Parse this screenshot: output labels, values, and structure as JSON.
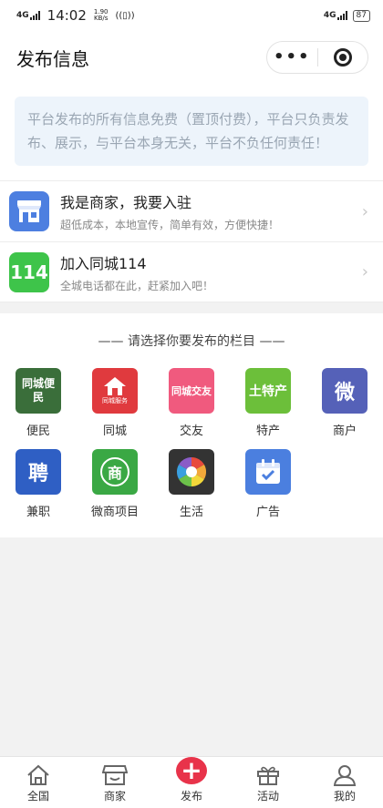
{
  "status_bar": {
    "network_left": "4G",
    "time": "14:02",
    "speed_value": "1.90",
    "speed_unit": "KB/s",
    "network_right": "4G",
    "battery": "87"
  },
  "nav": {
    "title": "发布信息"
  },
  "notice": {
    "text": "平台发布的所有信息免费（置顶付费），平台只负责发布、展示，与平台本身无关，平台不负任何责任！"
  },
  "entries": [
    {
      "title": "我是商家，我要入驻",
      "subtitle": "超低成本，本地宣传，简单有效，方便快捷！",
      "icon": "storefront-icon"
    },
    {
      "title": "加入同城114",
      "subtitle": "全城电话都在此，赶紧加入吧！",
      "icon": "114-icon",
      "icon_text": "114"
    }
  ],
  "section": {
    "title": "—— 请选择你要发布的栏目 ——"
  },
  "categories": [
    {
      "label": "便民",
      "icon": "tongcheng-bianmin-icon",
      "icon_text": "同城便民",
      "color": "#3a6e3a"
    },
    {
      "label": "同城",
      "icon": "tongcheng-house-icon",
      "icon_text": "同城服务",
      "color": "#e03a3e"
    },
    {
      "label": "交友",
      "icon": "jiaoyou-icon",
      "icon_text": "同城交友",
      "color": "#f05a7e"
    },
    {
      "label": "特产",
      "icon": "techan-icon",
      "icon_text": "土特产",
      "color": "#6cbf3a"
    },
    {
      "label": "商户",
      "icon": "wei-bang-icon",
      "icon_text": "微",
      "color": "#5561b8"
    },
    {
      "label": "兼职",
      "icon": "pin-icon",
      "icon_text": "聘",
      "color": "#2f5fc4"
    },
    {
      "label": "微商项目",
      "icon": "shang-icon",
      "icon_text": "商",
      "color": "#3aa844"
    },
    {
      "label": "生活",
      "icon": "camera-aperture-icon",
      "icon_text": "",
      "color": "#333333"
    },
    {
      "label": "广告",
      "icon": "calendar-check-icon",
      "icon_text": "",
      "color": "#4b7fdf"
    }
  ],
  "tabs": [
    {
      "label": "全国",
      "icon": "home-icon"
    },
    {
      "label": "商家",
      "icon": "store-icon"
    },
    {
      "label": "发布",
      "icon": "plus-icon",
      "symbol": "+"
    },
    {
      "label": "活动",
      "icon": "gift-icon"
    },
    {
      "label": "我的",
      "icon": "user-icon"
    }
  ],
  "colors": {
    "accent": "#e8334a",
    "notice_bg": "#edf4fb",
    "notice_text": "#9aa6b3"
  }
}
